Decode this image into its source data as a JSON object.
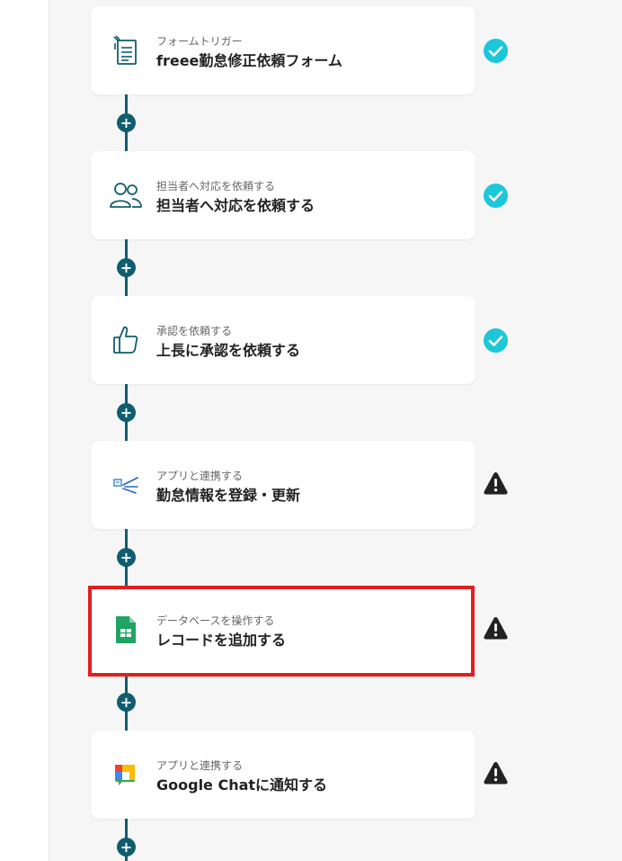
{
  "steps": [
    {
      "subtitle": "フォームトリガー",
      "title": "freee勤怠修正依頼フォーム",
      "icon": "form-icon",
      "status": "done",
      "status_icon": "check-circle-icon"
    },
    {
      "subtitle": "担当者へ対応を依頼する",
      "title": "担当者へ対応を依頼する",
      "icon": "people-icon",
      "status": "done",
      "status_icon": "check-circle-icon"
    },
    {
      "subtitle": "承認を依頼する",
      "title": "上長に承認を依頼する",
      "icon": "thumbs-up-icon",
      "status": "done",
      "status_icon": "check-circle-icon"
    },
    {
      "subtitle": "アプリと連携する",
      "title": "勤怠情報を登録・更新",
      "icon": "freee-logo-icon",
      "status": "warning",
      "status_icon": "warning-icon"
    },
    {
      "subtitle": "データベースを操作する",
      "title": "レコードを追加する",
      "icon": "google-sheets-icon",
      "status": "warning",
      "status_icon": "warning-icon",
      "highlighted": true
    },
    {
      "subtitle": "アプリと連携する",
      "title": "Google Chatに通知する",
      "icon": "google-chat-icon",
      "status": "warning",
      "status_icon": "warning-icon"
    }
  ],
  "add_button_label": "+",
  "colors": {
    "connector": "#0f5e6f",
    "check": "#1cc7d9",
    "warning": "#222222",
    "highlight": "#e02020",
    "sheets": "#1fa463"
  }
}
